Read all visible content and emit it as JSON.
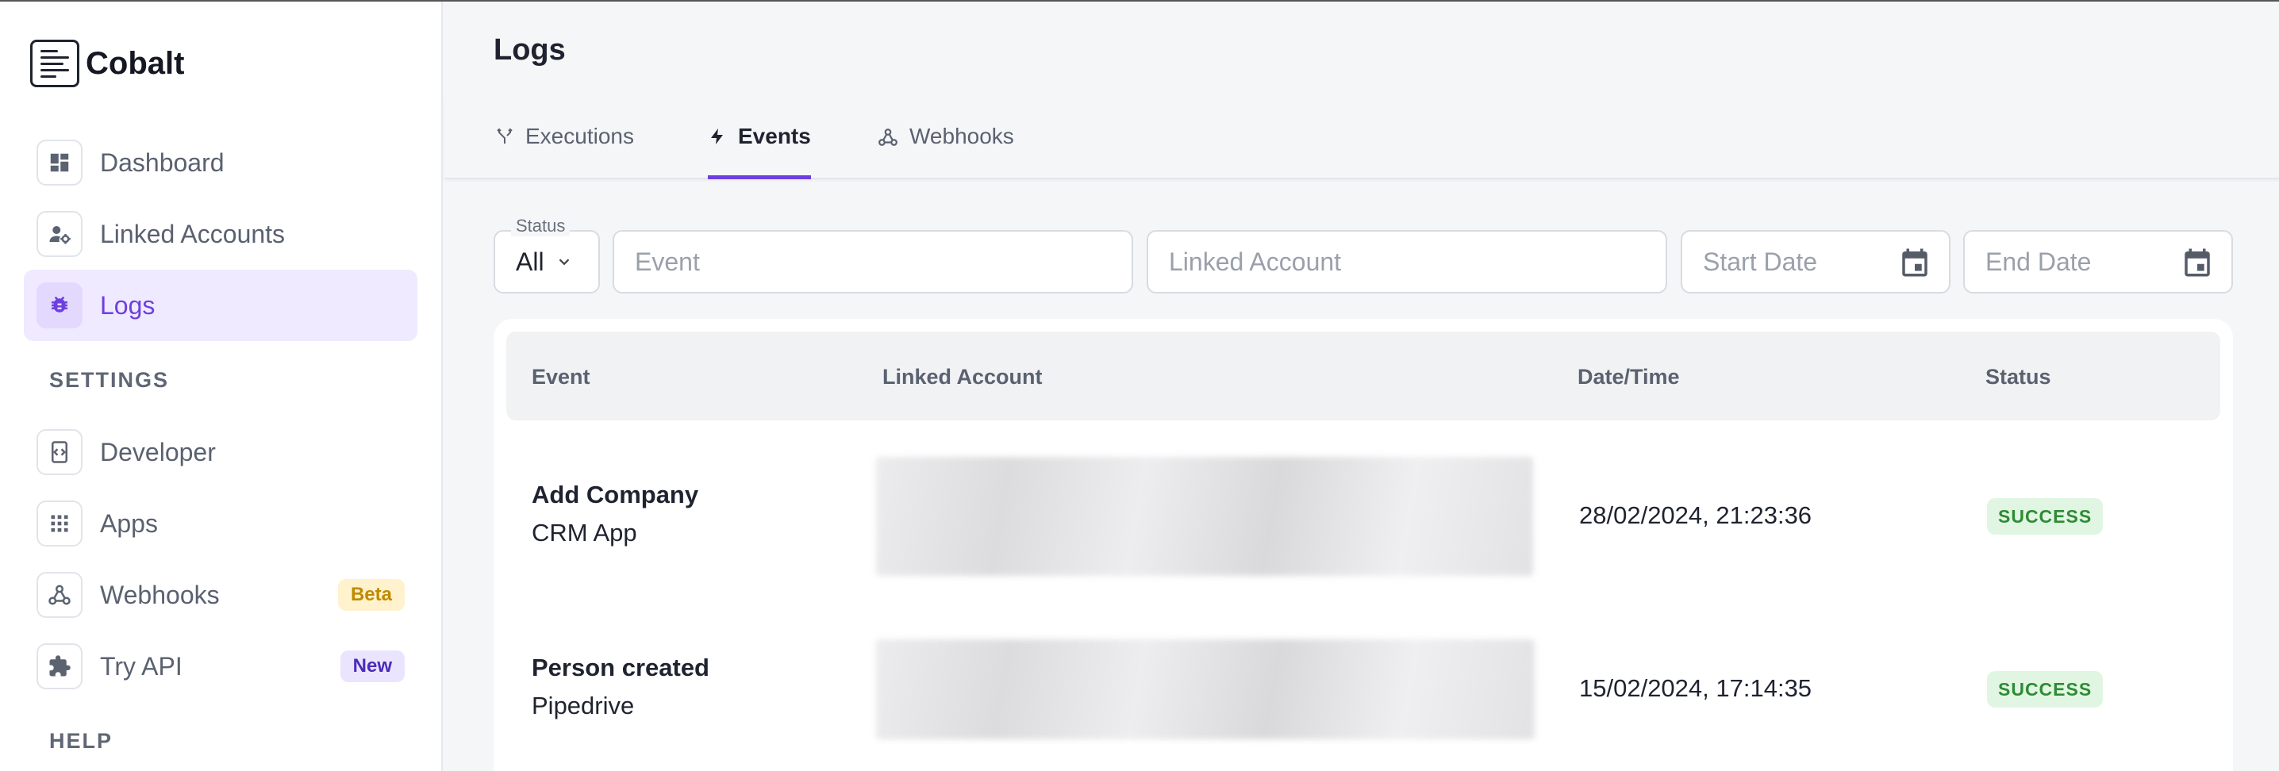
{
  "brand": {
    "name": "Cobalt"
  },
  "sidebar": {
    "items": [
      {
        "label": "Dashboard",
        "icon": "dashboard-icon"
      },
      {
        "label": "Linked Accounts",
        "icon": "user-settings-icon"
      },
      {
        "label": "Logs",
        "icon": "bug-icon",
        "active": true
      }
    ],
    "settings_header": "SETTINGS",
    "settings_items": [
      {
        "label": "Developer",
        "icon": "developer-icon"
      },
      {
        "label": "Apps",
        "icon": "apps-grid-icon"
      },
      {
        "label": "Webhooks",
        "icon": "webhook-icon",
        "badge": "Beta"
      },
      {
        "label": "Try API",
        "icon": "puzzle-icon",
        "badge": "New"
      }
    ],
    "help_header": "HELP"
  },
  "page": {
    "title": "Logs"
  },
  "tabs": [
    {
      "label": "Executions",
      "icon": "fork-icon"
    },
    {
      "label": "Events",
      "icon": "bolt-icon",
      "active": true
    },
    {
      "label": "Webhooks",
      "icon": "webhook-icon"
    }
  ],
  "filters": {
    "status_legend": "Status",
    "status_value": "All",
    "event_placeholder": "Event",
    "linked_account_placeholder": "Linked Account",
    "start_date_placeholder": "Start Date",
    "end_date_placeholder": "End Date"
  },
  "table": {
    "columns": [
      "Event",
      "Linked Account",
      "Date/Time",
      "Status"
    ],
    "rows": [
      {
        "event": "Add Company",
        "app": "CRM App",
        "datetime": "28/02/2024, 21:23:36",
        "status": "SUCCESS"
      },
      {
        "event": "Person created",
        "app": "Pipedrive",
        "datetime": "15/02/2024, 17:14:35",
        "status": "SUCCESS"
      }
    ]
  },
  "colors": {
    "accent": "#6d3fe0",
    "success_bg": "#e1f6e2",
    "success_text": "#2e8b35"
  }
}
